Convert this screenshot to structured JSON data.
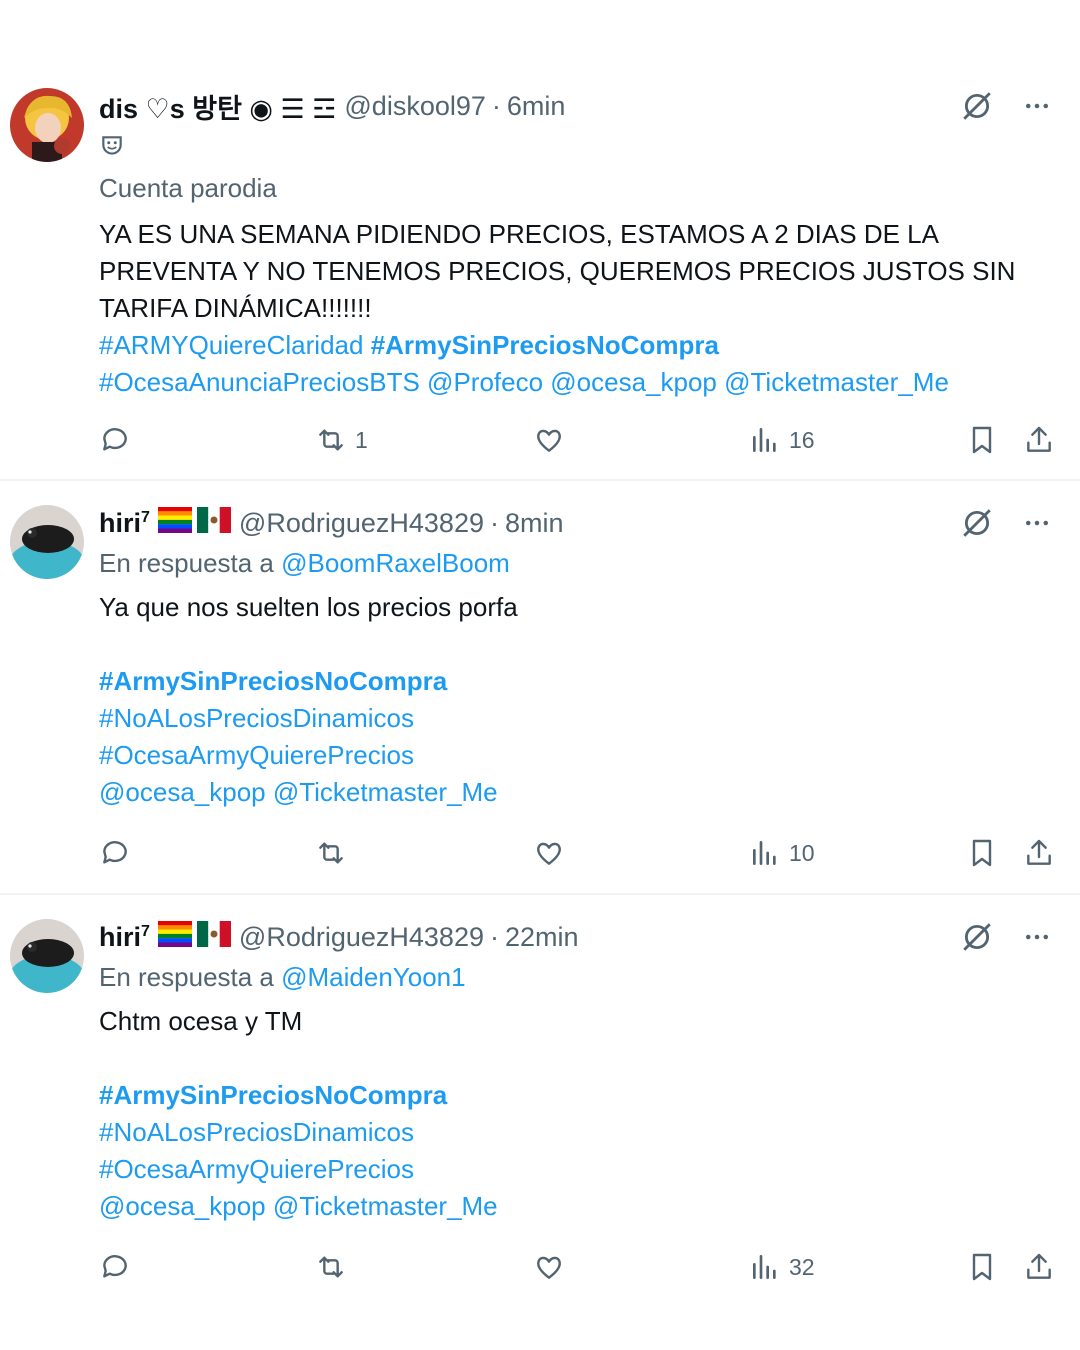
{
  "colors": {
    "link": "#1d9bf0",
    "muted": "#536471",
    "text": "#0f1419",
    "divider": "#eff3f4"
  },
  "tweets": [
    {
      "name": "dis ♡s 방탄 ◉ ☰ ☲",
      "handle": "@diskool97",
      "dot": "·",
      "time": "6min",
      "badge_icon": "theater-mask-icon",
      "parody_label": "Cuenta parodia",
      "text": "YA ES UNA SEMANA PIDIENDO PRECIOS, ESTAMOS A 2 DIAS DE LA PREVENTA Y NO TENEMOS PRECIOS, QUEREMOS PRECIOS JUSTOS SIN TARIFA DINÁMICA!!!!!!!",
      "links_line1": [
        " #ARMYQuiereClaridad",
        "#ArmySinPreciosNoCompra"
      ],
      "links_line2": "#OcesaAnunciaPreciosBTS @Profeco @ocesa_kpop @Ticketmaster_Me",
      "retweets": "1",
      "views": "16"
    },
    {
      "name": "hiri",
      "name_sup": "7",
      "flags": [
        "rainbow-flag-icon",
        "mexico-flag-icon"
      ],
      "handle": "@RodriguezH43829",
      "dot": "·",
      "time": "8min",
      "reply_prefix": "En respuesta a",
      "reply_to": "@BoomRaxelBoom",
      "text": "Ya que nos suelten los precios porfa",
      "hashtag_bold": "#ArmySinPreciosNoCompra",
      "hashtag2": "#NoALosPreciosDinamicos",
      "hashtag3": "#OcesaArmyQuierePrecios",
      "mentions": "@ocesa_kpop @Ticketmaster_Me",
      "views": "10"
    },
    {
      "name": "hiri",
      "name_sup": "7",
      "flags": [
        "rainbow-flag-icon",
        "mexico-flag-icon"
      ],
      "handle": "@RodriguezH43829",
      "dot": "·",
      "time": "22min",
      "reply_prefix": "En respuesta a",
      "reply_to": "@MaidenYoon1",
      "text": "Chtm ocesa y TM",
      "hashtag_bold": "#ArmySinPreciosNoCompra",
      "hashtag2": "#NoALosPreciosDinamicos",
      "hashtag3": "#OcesaArmyQuierePrecios",
      "mentions": "@ocesa_kpop @Ticketmaster_Me",
      "views": "32"
    }
  ]
}
